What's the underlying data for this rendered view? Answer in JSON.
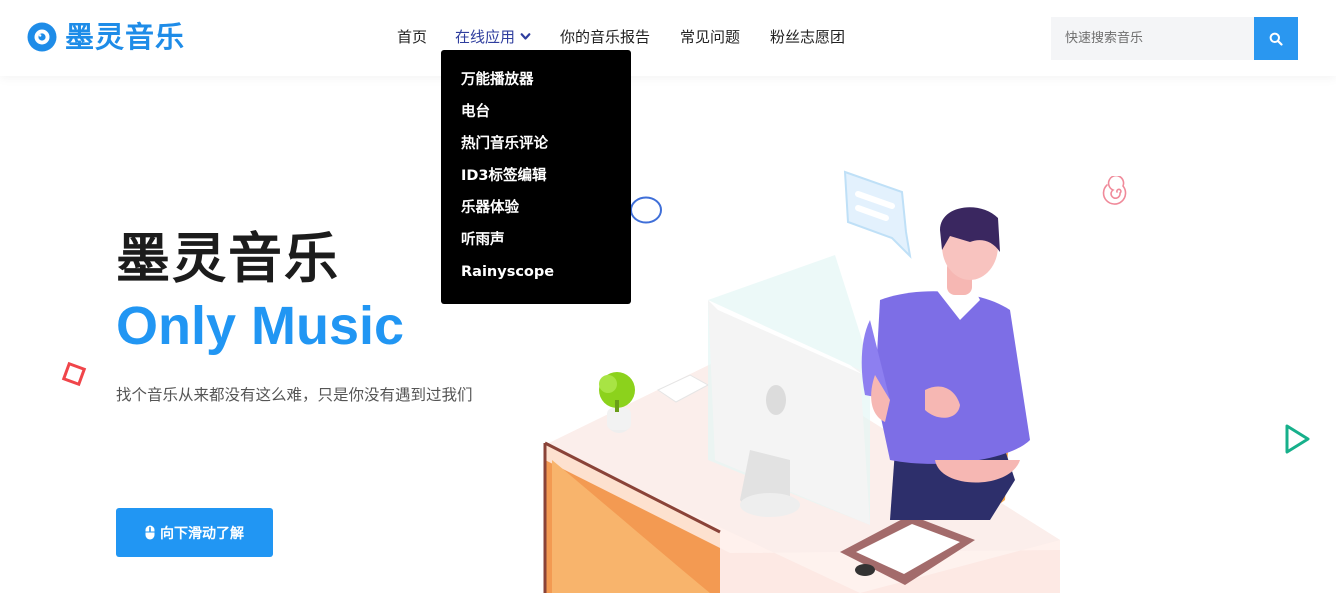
{
  "brand": {
    "name": "墨灵音乐",
    "accent": "#1e8ce8"
  },
  "nav": {
    "items": [
      {
        "label": "首页"
      },
      {
        "label": "在线应用"
      },
      {
        "label": "你的音乐报告"
      },
      {
        "label": "常见问题"
      },
      {
        "label": "粉丝志愿团"
      }
    ],
    "dropdown": [
      {
        "label": "万能播放器"
      },
      {
        "label": "电台"
      },
      {
        "label": "热门音乐评论"
      },
      {
        "label": "ID3标签编辑"
      },
      {
        "label": "乐器体验"
      },
      {
        "label": "听雨声"
      },
      {
        "label": "Rainyscope"
      }
    ]
  },
  "search": {
    "placeholder": "快速搜索音乐",
    "value": "",
    "icon": "search-icon"
  },
  "hero": {
    "title": "墨灵音乐",
    "subtitle": "Only Music",
    "description": "找个音乐从来都没有这么难，只是你没有遇到过我们",
    "cta_label": "向下滑动了解",
    "cta_icon": "mouse-icon",
    "colors": {
      "title": "#1c1c1c",
      "subtitle": "#2196f3",
      "button": "#2196f3"
    }
  }
}
